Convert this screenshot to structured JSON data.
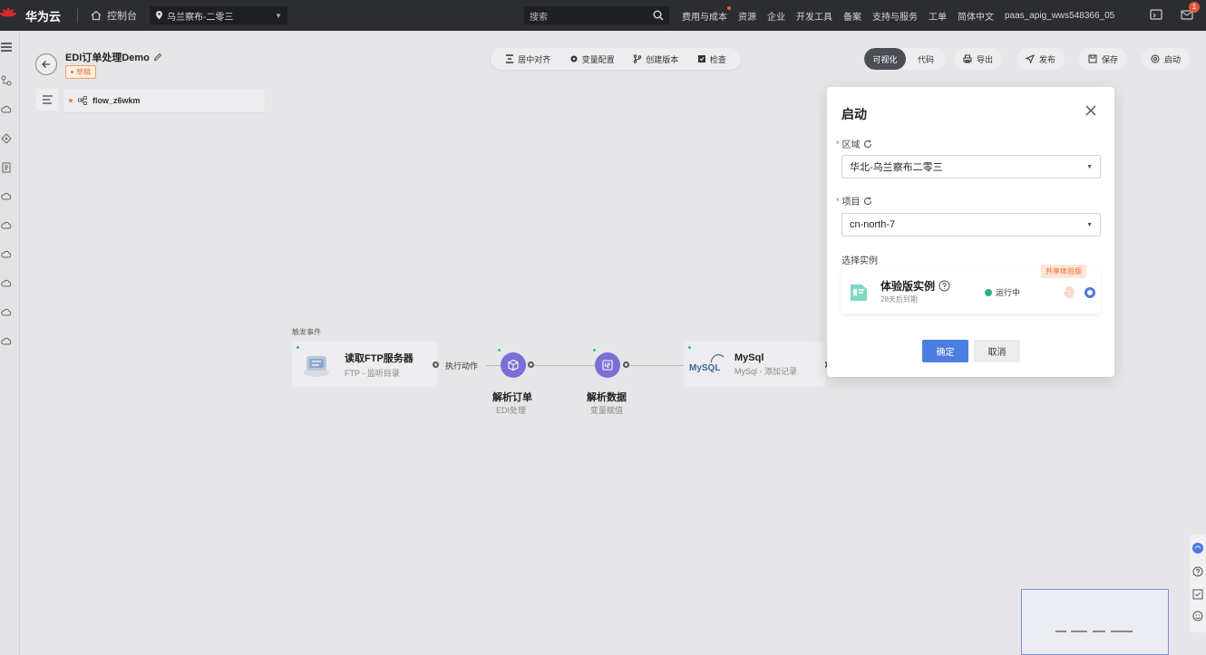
{
  "topbar": {
    "brand": "华为云",
    "console": "控制台",
    "region": "乌兰察布-二零三",
    "search_placeholder": "搜索",
    "nav": [
      "费用与成本",
      "资源",
      "企业",
      "开发工具",
      "备案",
      "支持与服务",
      "工单",
      "简体中文",
      "paas_apig_wws548366_05"
    ],
    "badge": "1"
  },
  "flow": {
    "title": "EDI订单处理Demo",
    "status": "草稿",
    "tab": "flow_z6wkm"
  },
  "toolbar": {
    "center": "居中对齐",
    "vars": "变量配置",
    "version": "创建版本",
    "check": "检查",
    "mode_visual": "可视化",
    "mode_code": "代码",
    "export": "导出",
    "publish": "发布",
    "save": "保存",
    "start": "启动"
  },
  "canvas": {
    "trigger_label": "触发事件",
    "ftp_title": "读取FTP服务器",
    "ftp_sub": "FTP - 监听目录",
    "exec_label": "执行动作",
    "parse_order_title": "解析订单",
    "parse_order_sub": "EDI处理",
    "parse_data_title": "解析数据",
    "parse_data_sub": "变量赋值",
    "mysql_logo": "MySQL",
    "mysql_title": "MySql",
    "mysql_sub": "MySql - 添加记录"
  },
  "modal": {
    "title": "启动",
    "region_label": "区域",
    "region_value": "华北-乌兰察布二零三",
    "project_label": "项目",
    "project_value": "cn-north-7",
    "instance_label": "选择实例",
    "instance_name": "体验版实例",
    "instance_sub": "28天后到期",
    "instance_status": "运行中",
    "instance_tag": "共享体验版",
    "ok": "确定",
    "cancel": "取消"
  },
  "colors": {
    "primary": "#4c7ee2",
    "node_purple": "#7a6fd6",
    "topbar": "#2b2d31",
    "running": "#25b28c",
    "draft": "#e07a3a"
  }
}
